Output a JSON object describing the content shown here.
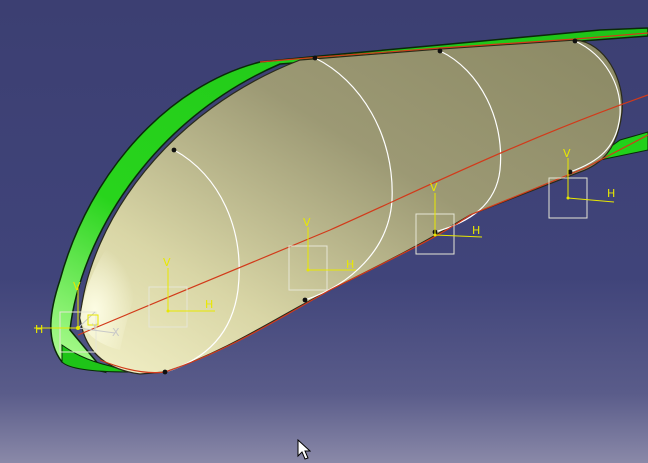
{
  "viewer": {
    "colors": {
      "background_top": "#3c3f72",
      "background_bottom": "#8a89a8",
      "surface_green": "#22d01a",
      "surface_body": "#b9b58a",
      "section_lines": "#ffffff",
      "guide_curve": "#d23a1a",
      "axis_color": "#e8e800",
      "axis_gray": "#c8c8c8"
    },
    "sketch_planes": [
      {
        "v_label": "V",
        "h_label": "H"
      },
      {
        "v_label": "V",
        "h_label": "H"
      },
      {
        "v_label": "V",
        "h_label": "H"
      },
      {
        "v_label": "V",
        "h_label": "H"
      }
    ],
    "compass": {
      "v_label": "V",
      "h_label": "H",
      "x_label": "X",
      "y_label": "Y"
    },
    "cursor": "arrow-pointer-icon"
  }
}
